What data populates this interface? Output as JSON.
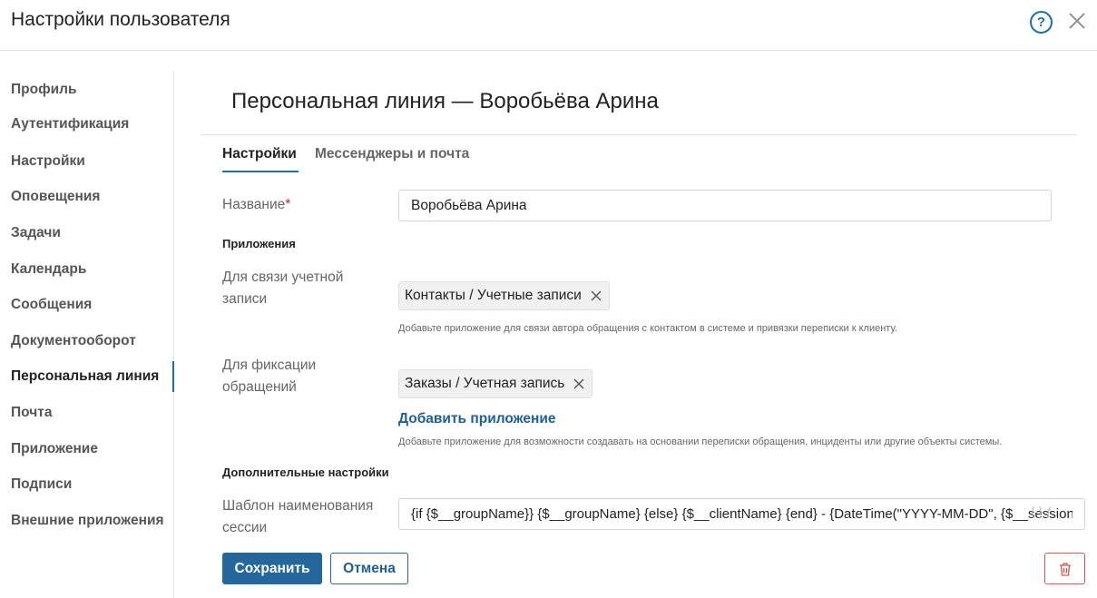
{
  "header": {
    "title": "Настройки пользователя",
    "help_icon": "help-circle-icon",
    "help_glyph": "?",
    "close_icon": "close-icon"
  },
  "sidebar": {
    "items": [
      {
        "label": "Профиль"
      },
      {
        "label": "Аутентификация"
      },
      {
        "label": "Настройки"
      },
      {
        "label": "Оповещения"
      },
      {
        "label": "Задачи"
      },
      {
        "label": "Календарь"
      },
      {
        "label": "Сообщения"
      },
      {
        "label": "Документооборот"
      },
      {
        "label": "Персональная линия",
        "active": true
      },
      {
        "label": "Почта"
      },
      {
        "label": "Приложение"
      },
      {
        "label": "Подписи"
      },
      {
        "label": "Внешние приложения"
      }
    ]
  },
  "main": {
    "title": "Персональная линия — Воробьёва Арина",
    "tabs": [
      {
        "label": "Настройки",
        "active": true
      },
      {
        "label": "Мессенджеры и почта",
        "active": false
      }
    ],
    "form": {
      "name_label": "Название",
      "required_mark": "*",
      "name_value": "Воробьёва Арина",
      "apps_section": "Приложения",
      "account_link_label": "Для связи учетной записи",
      "account_link_chip": "Контакты / Учетные записи",
      "account_link_hint": "Добавьте приложение для связи автора обращения с контактом в системе и привязки переписки к клиенту.",
      "fixation_label": "Для фиксации обращений",
      "fixation_chip": "Заказы / Учетная запись",
      "add_app_link": "Добавить приложение",
      "fixation_hint": "Добавьте приложение для возможности создавать на основании переписки обращения, инциденты или другие объекты системы.",
      "extra_section": "Дополнительные настройки",
      "template_label": "Шаблон наименования сессии",
      "template_value": "{if {$__groupName}} {$__groupName} {else} {$__clientName} {end} - {DateTime(\"YYYY-MM-DD\", {$__sessionStart})}",
      "template_icons": "{·}  ƒ"
    },
    "actions": {
      "save": "Сохранить",
      "cancel": "Отмена",
      "delete_icon": "trash-icon"
    }
  },
  "colors": {
    "accent": "#24679c",
    "link": "#1e5f99",
    "danger": "#d9534f",
    "required": "#cc2a2a"
  }
}
